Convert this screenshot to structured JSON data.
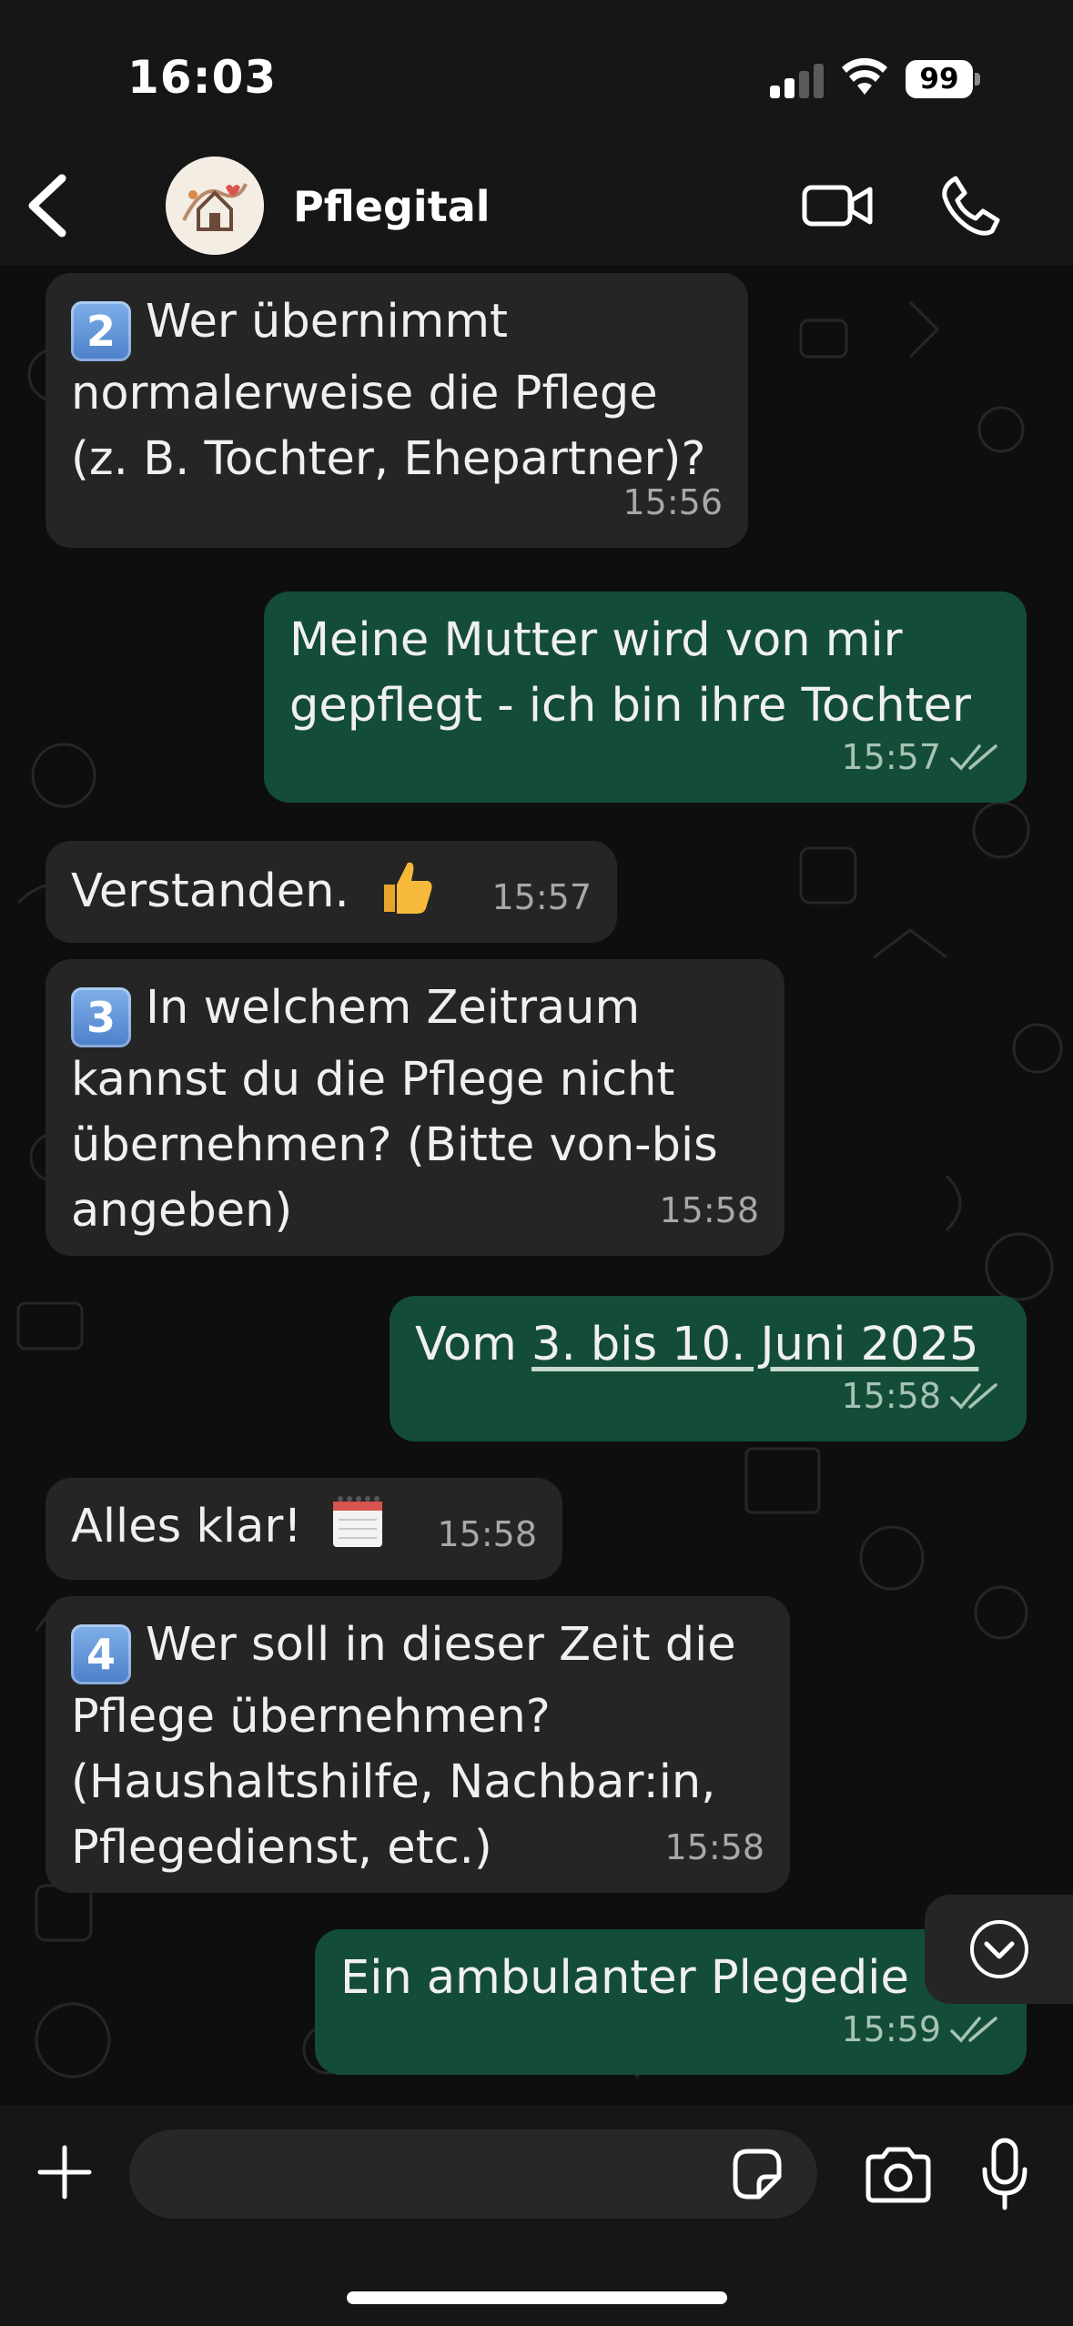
{
  "status_bar": {
    "time": "16:03",
    "battery": "99"
  },
  "header": {
    "contact_name": "Pflegital",
    "back_icon": "chevron-left-icon",
    "video_icon": "video-camera-icon",
    "call_icon": "phone-icon"
  },
  "messages": [
    {
      "direction": "incoming",
      "keycap": "2",
      "text": "Wer übernimmt normalerweise die Pflege (z. B. Tochter, Ehepartner)?",
      "time": "15:56"
    },
    {
      "direction": "outgoing",
      "text": "Meine Mutter wird von mir gepflegt - ich bin ihre Tochter",
      "time": "15:57",
      "status": "read"
    },
    {
      "direction": "incoming",
      "text": "Verstanden.",
      "emoji": "thumbs-up",
      "time": "15:57"
    },
    {
      "direction": "incoming",
      "keycap": "3",
      "text": "In welchem Zeitraum kannst du die Pflege nicht übernehmen? (Bitte von-bis angeben)",
      "time": "15:58"
    },
    {
      "direction": "outgoing",
      "text_prefix": "Vom ",
      "text_link": "3. bis 10. Juni 2025",
      "time": "15:58",
      "status": "read"
    },
    {
      "direction": "incoming",
      "text": "Alles klar!",
      "emoji": "calendar",
      "time": "15:58"
    },
    {
      "direction": "incoming",
      "keycap": "4",
      "text": "Wer soll in dieser Zeit die Pflege übernehmen? (Haushaltshilfe, Nachbar:in, Pflegedienst, etc.)",
      "time": "15:58"
    },
    {
      "direction": "outgoing",
      "text": "Ein ambulanter Plegedie",
      "time": "15:59",
      "status": "read"
    }
  ],
  "composer": {
    "placeholder": "",
    "value": ""
  },
  "colors": {
    "incoming_bubble": "#252525",
    "outgoing_bubble": "#144d37",
    "background": "#0e0e0e",
    "bar": "#161616"
  }
}
